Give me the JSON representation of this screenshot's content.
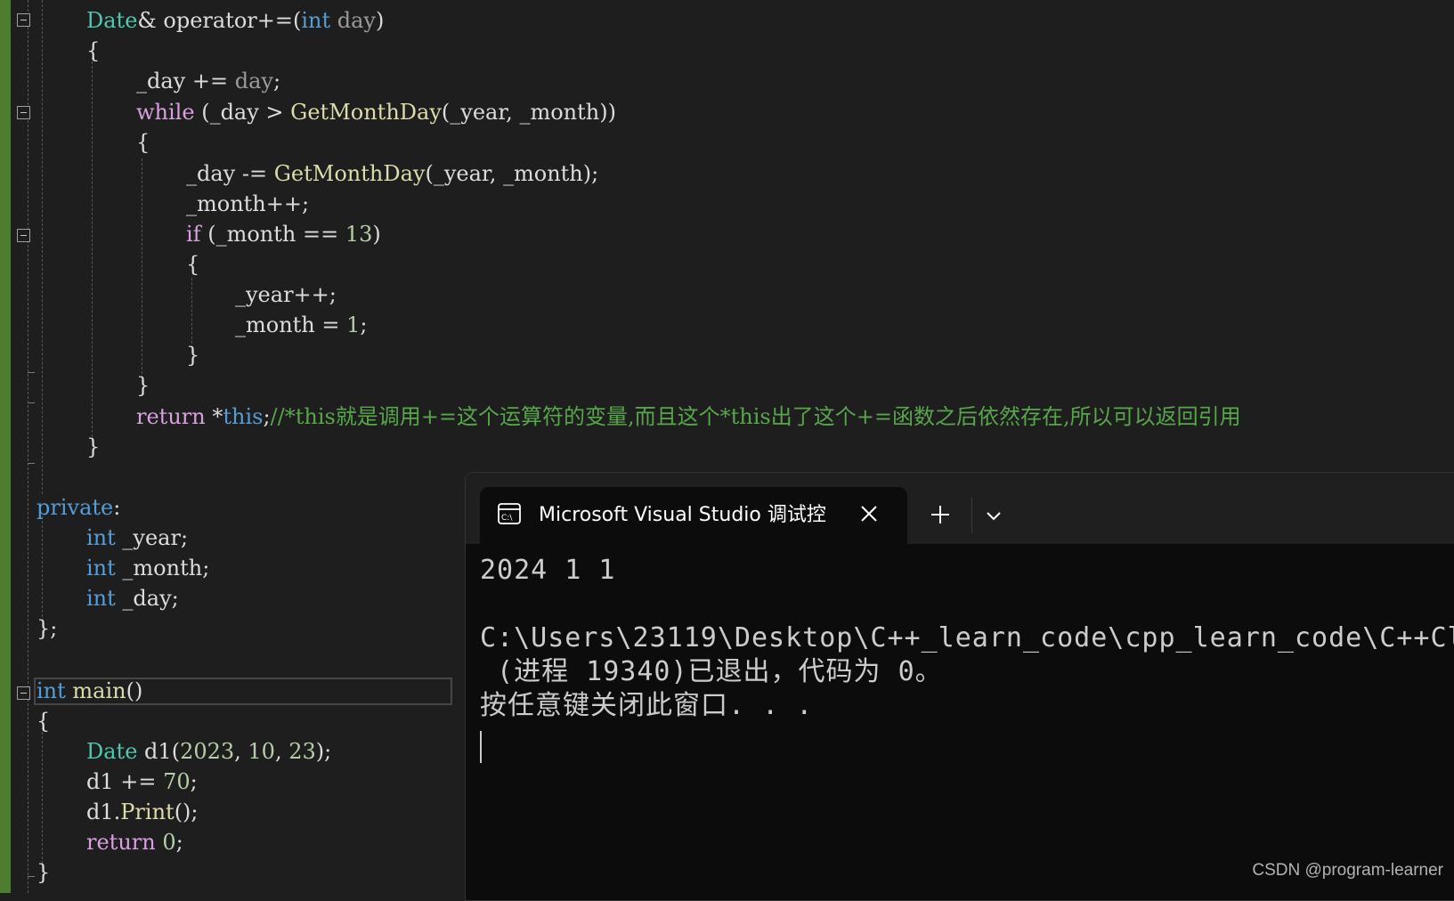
{
  "code": {
    "l1": {
      "t1": "Date",
      "t2": "& operator+=(",
      "t3": "int",
      "t4": " day",
      "t5": ")"
    },
    "l2": "{",
    "l3": {
      "t1": "_day",
      "t2": " += ",
      "t3": "day",
      "t4": ";"
    },
    "l4": {
      "t1": "while",
      "t2": " (",
      "t3": "_day",
      "t4": " > ",
      "t5": "GetMonthDay",
      "t6": "(",
      "t7": "_year",
      "t8": ", ",
      "t9": "_month",
      "t10": "))"
    },
    "l5": "{",
    "l6": {
      "t1": "_day",
      "t2": " -= ",
      "t3": "GetMonthDay",
      "t4": "(",
      "t5": "_year",
      "t6": ", ",
      "t7": "_month",
      "t8": ");"
    },
    "l7": {
      "t1": "_month",
      "t2": "++;"
    },
    "l8": {
      "t1": "if",
      "t2": " (",
      "t3": "_month",
      "t4": " == ",
      "t5": "13",
      "t6": ")"
    },
    "l9": "{",
    "l10": {
      "t1": "_year",
      "t2": "++;"
    },
    "l11": {
      "t1": "_month",
      "t2": " = ",
      "t3": "1",
      "t4": ";"
    },
    "l12": "}",
    "l13": "}",
    "l14": {
      "t1": "return",
      "t2": " *",
      "t3": "this",
      "t4": ";",
      "t5": "//*this就是调用+=这个运算符的变量,而且这个*this出了这个+=函数之后依然存在,所以可以返回引用"
    },
    "l15": "}",
    "l16": {
      "t1": "private",
      "t2": ":"
    },
    "l17": {
      "t1": "int",
      "t2": " _year",
      "t3": ";"
    },
    "l18": {
      "t1": "int",
      "t2": " _month",
      "t3": ";"
    },
    "l19": {
      "t1": "int",
      "t2": " _day",
      "t3": ";"
    },
    "l20": "};",
    "l21": {
      "t1": "int",
      "t2": " ",
      "t3": "main",
      "t4": "()"
    },
    "l22": "{",
    "l23": {
      "t1": "Date",
      "t2": " ",
      "t3": "d1",
      "t4": "(",
      "t5": "2023",
      "t6": ", ",
      "t7": "10",
      "t8": ", ",
      "t9": "23",
      "t10": ");"
    },
    "l24": {
      "t1": "d1",
      "t2": " += ",
      "t3": "70",
      "t4": ";"
    },
    "l25": {
      "t1": "d1",
      "t2": ".",
      "t3": "Print",
      "t4": "();"
    },
    "l26": {
      "t1": "return",
      "t2": " ",
      "t3": "0",
      "t4": ";"
    },
    "l27": "}"
  },
  "terminal": {
    "tab_title": "Microsoft Visual Studio 调试控",
    "icon": "console-app-icon",
    "output": [
      "2024 1 1",
      "",
      "C:\\Users\\23119\\Desktop\\C++_learn_code\\cpp_learn_code\\C++Cl",
      " (进程 19340)已退出，代码为 0。",
      "按任意键关闭此窗口. . ."
    ]
  },
  "watermark": "CSDN @program-learner",
  "colors": {
    "editor_bg": "#1e1e1e",
    "keyword": "#569cd6",
    "control": "#d8a0df",
    "type": "#4ec9b0",
    "function": "#dcdcaa",
    "number": "#b5cea8",
    "comment": "#57a64a",
    "terminal_bg": "#0c0c0c"
  }
}
